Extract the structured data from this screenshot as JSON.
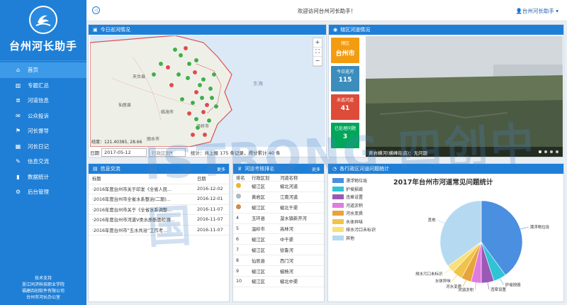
{
  "sidebar": {
    "app_title": "台州河长助手",
    "items": [
      {
        "label": "首页",
        "icon": "home-icon"
      },
      {
        "label": "专题汇总",
        "icon": "book-icon"
      },
      {
        "label": "河道信息",
        "icon": "list-icon"
      },
      {
        "label": "公众投诉",
        "icon": "chat-icon"
      },
      {
        "label": "河长督导",
        "icon": "flag-icon"
      },
      {
        "label": "河长日记",
        "icon": "calendar-icon"
      },
      {
        "label": "信息交流",
        "icon": "message-icon"
      },
      {
        "label": "数据统计",
        "icon": "chart-icon"
      },
      {
        "label": "后台管理",
        "icon": "gear-icon"
      }
    ],
    "support": [
      "技术支持",
      "浙江同济科技职业学院",
      "福建四创软件有限公司",
      "台州市河长办公室"
    ]
  },
  "topbar": {
    "welcome": "欢迎访问台州河长助手！",
    "user": "台州河长助手"
  },
  "map_panel": {
    "title": "今日巡河情况",
    "coords": "经度：121.40385, 28.66",
    "date_label": "日期",
    "date_value": "2017-05-12",
    "region_placeholder": "行政区划",
    "stats": "统计：共上报 175 条记录，得分累计 40 条"
  },
  "river_panel": {
    "title": "辖区河道情况",
    "buttons": [
      {
        "label": "辖区",
        "value": "台州市",
        "color": "#f39c12"
      },
      {
        "label": "今日巡河",
        "value": "115",
        "color": "#3c8dbc"
      },
      {
        "label": "未巡河道",
        "value": "41",
        "color": "#dd4b39"
      },
      {
        "label": "已处理问题",
        "value": "3",
        "color": "#00a65a"
      }
    ],
    "caption": "黄岩横河(横峰街道)：无问题"
  },
  "info_panel": {
    "title": "信息交流",
    "more": "更多",
    "headers": [
      "标题",
      "日期"
    ],
    "rows": [
      [
        "·2016年度台州市关于印发《全省人民...",
        "2016-12-02"
      ],
      [
        "·2016年度台州市全省水系整治(二期)...",
        "2016-12-01"
      ],
      [
        "·2016年度台州市关于《全省水系调整...",
        "2016-11-07"
      ],
      [
        "·2016年度台州市河道V类水质断面检测...",
        "2016-11-07"
      ],
      [
        "·2016年度台州市“五水共治”工作考...",
        "2016-11-07"
      ]
    ]
  },
  "rank_panel": {
    "title": "河道考核排名",
    "more": "更多",
    "headers": [
      "排名",
      "行政区划",
      "河道名称"
    ],
    "rows": [
      [
        "1",
        "椒江区",
        "椒北河道"
      ],
      [
        "2",
        "黄岩区",
        "江南河道"
      ],
      [
        "3",
        "椒江区",
        "椒北干渠"
      ],
      [
        "4",
        "玉环县",
        "漩水镇新开河"
      ],
      [
        "5",
        "温岭市",
        "高林河"
      ],
      [
        "6",
        "椒江区",
        "中干渠"
      ],
      [
        "7",
        "椒江区",
        "徐鲁河"
      ],
      [
        "8",
        "仙居县",
        "西门河"
      ],
      [
        "9",
        "椒江区",
        "椒杨河"
      ],
      [
        "10",
        "椒江区",
        "椒北中渠"
      ]
    ]
  },
  "chart_panel": {
    "title": "各行政区河道问题统计"
  },
  "chart_data": {
    "type": "pie",
    "title": "2017年台州市河道常见问题统计",
    "categories": [
      "漂浮物垃圾",
      "护坡损毁",
      "违章设置",
      "河道淤积",
      "河水变质",
      "水体异味",
      "排水污口未标识",
      "其他"
    ],
    "values": [
      40,
      5,
      5,
      4,
      4,
      4,
      3,
      35
    ],
    "colors": [
      "#4a8fe0",
      "#2ec4d6",
      "#9b59b6",
      "#e07be0",
      "#e8a33a",
      "#f0c34a",
      "#f9e07a",
      "#b5d9f0"
    ],
    "legend_position": "left"
  },
  "watermark": "ISTRONG 四创中国"
}
